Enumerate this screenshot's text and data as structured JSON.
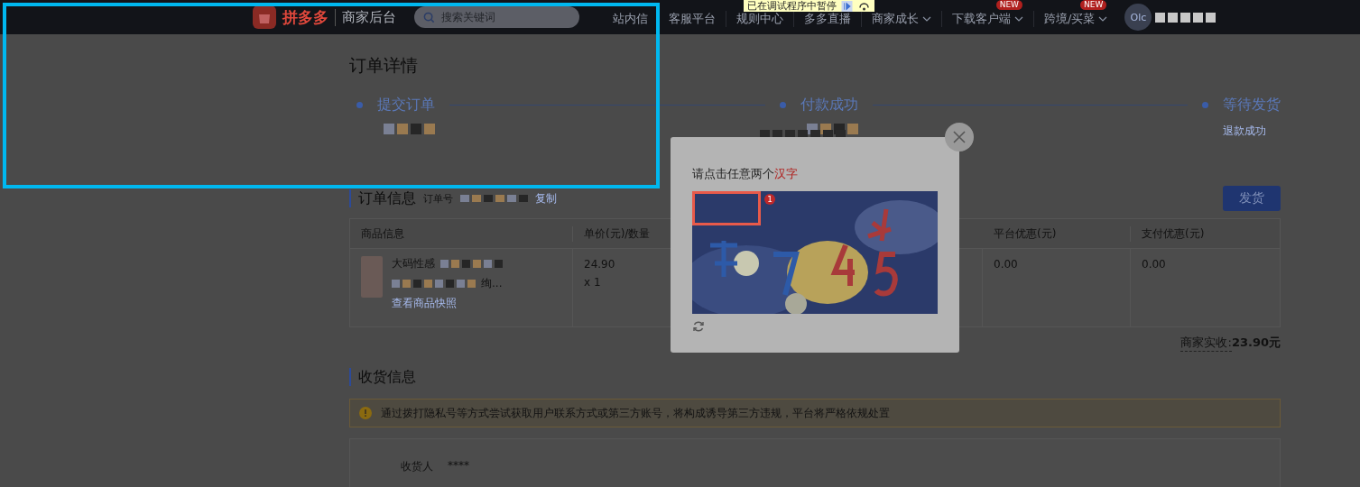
{
  "header": {
    "logo": "拼多多",
    "title": "商家后台",
    "search": {
      "placeholder": "搜索关键词"
    },
    "nav": [
      {
        "label": "站内信",
        "dropdown": false
      },
      {
        "label": "客服平台",
        "dropdown": false
      },
      {
        "label": "规则中心",
        "dropdown": false
      },
      {
        "label": "多多直播",
        "dropdown": false
      },
      {
        "label": "商家成长",
        "dropdown": true
      },
      {
        "label": "下载客户端",
        "dropdown": true,
        "badge": "NEW"
      },
      {
        "label": "跨境/买菜",
        "dropdown": true,
        "badge": "NEW"
      }
    ],
    "avatar": "Olc"
  },
  "debugger_banner": {
    "text": "已在调试程序中暂停"
  },
  "page_title": "订单详情",
  "steps": [
    {
      "label": "提交订单"
    },
    {
      "label": "付款成功"
    },
    {
      "label": "等待发货",
      "sub": "退款成功"
    }
  ],
  "order_info": {
    "title": "订单信息",
    "order_no_label": "订单号",
    "copy_link": "复制",
    "ship_button": "发货",
    "columns": [
      "商品信息",
      "单价(元)/数量",
      "平台优惠(元)",
      "支付优惠(元)"
    ],
    "rows": [
      {
        "product": "大码性感",
        "product_tail": "绚...",
        "snapshot_link": "查看商品快照",
        "price": "24.90",
        "qty": "x 1",
        "platform_discount": "0.00",
        "pay_discount": "0.00"
      }
    ],
    "merchant_income_label": "商家实收:",
    "merchant_income": "23.90元"
  },
  "shipping": {
    "title": "收货信息",
    "warning": "通过拨打隐私号等方式尝试获取用户联系方式或第三方账号，将构成诱导第三方违规，平台将严格依规处置",
    "fields": [
      {
        "label": "收货人",
        "value": "****"
      }
    ]
  },
  "captcha": {
    "prompt": "请点击任意两个",
    "target": "汉字",
    "marks": [
      "1"
    ]
  }
}
